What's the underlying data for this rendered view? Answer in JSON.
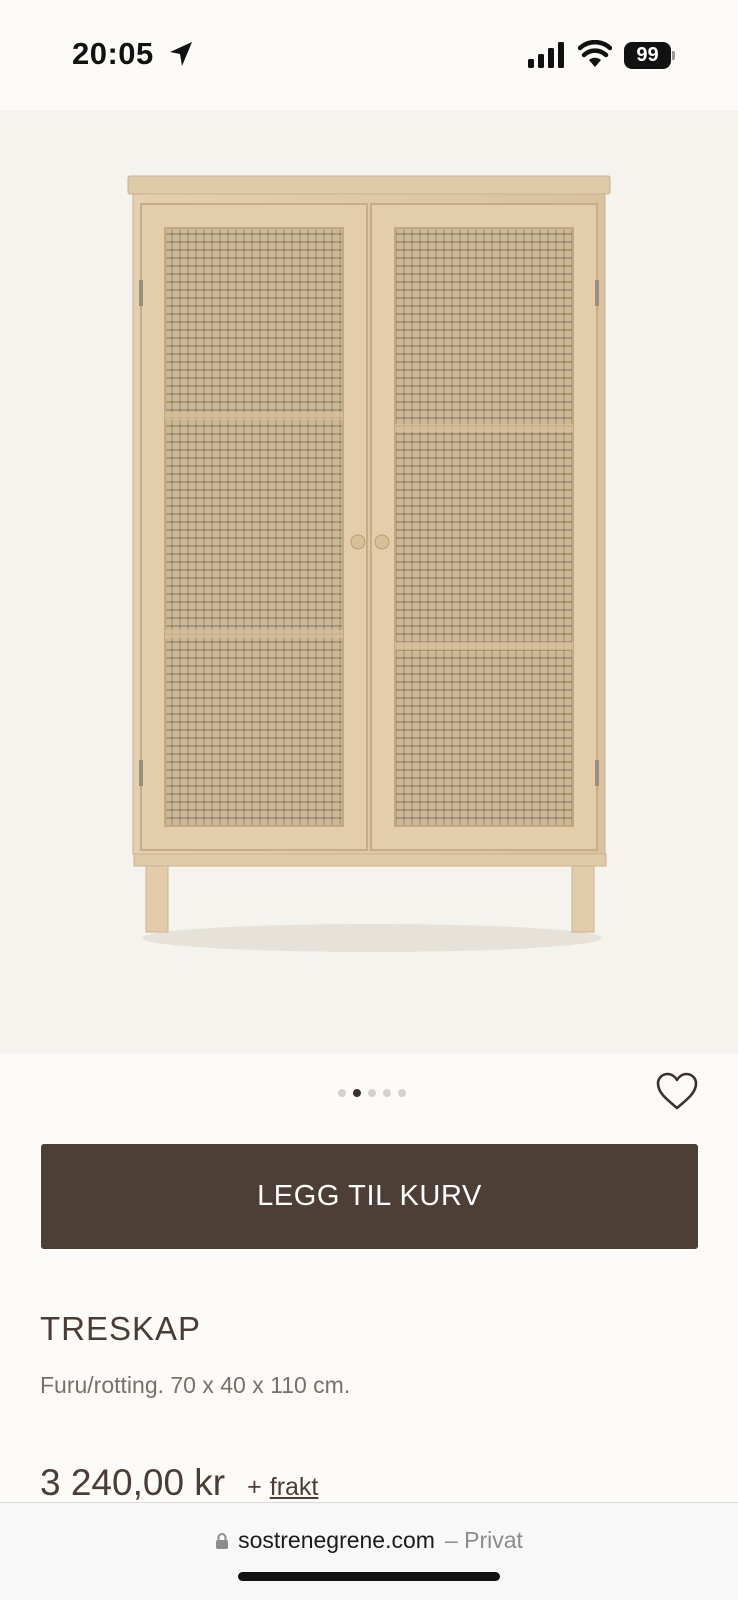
{
  "status_bar": {
    "time": "20:05",
    "battery": "99",
    "icons": [
      "location-arrow-icon",
      "signal-bars-icon",
      "wifi-icon",
      "battery-icon"
    ]
  },
  "product_image": {
    "alt": "rattan-cabinet-photo"
  },
  "carousel": {
    "total": 5,
    "active_index": 1
  },
  "actions": {
    "add_to_cart_label": "LEGG TIL KURV",
    "favorite_icon": "heart-icon"
  },
  "product": {
    "title": "TRESKAP",
    "description": "Furu/rotting. 70 x 40 x 110 cm.",
    "price": "3 240,00 kr",
    "shipping_prefix": "+",
    "shipping_link": "frakt"
  },
  "browser": {
    "domain": "sostrenegrene.com",
    "mode": "– Privat",
    "lock_icon": "lock-icon"
  },
  "colors": {
    "background": "#fcfbf7",
    "button": "#4d3f36",
    "text": "#4a3d36",
    "muted": "#7a706a"
  }
}
